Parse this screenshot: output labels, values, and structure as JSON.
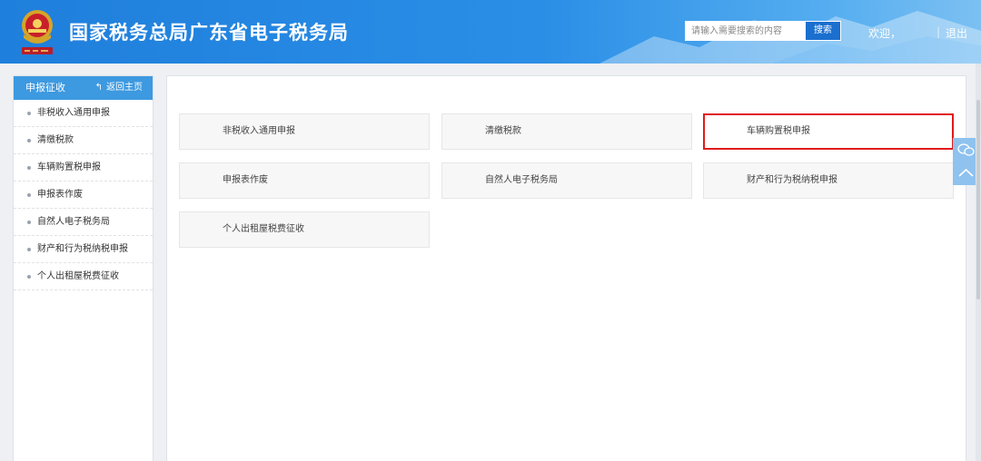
{
  "header": {
    "title": "国家税务总局广东省电子税务局",
    "search_placeholder": "请输入需要搜索的内容",
    "search_button": "搜索",
    "welcome": "欢迎，",
    "separator": "|",
    "logout": "退出"
  },
  "sidebar": {
    "heading": "申报征收",
    "back_label": "返回主页",
    "items": [
      {
        "label": "非税收入通用申报"
      },
      {
        "label": "清缴税款"
      },
      {
        "label": "车辆购置税申报"
      },
      {
        "label": "申报表作废"
      },
      {
        "label": "自然人电子税务局"
      },
      {
        "label": "财产和行为税纳税申报"
      },
      {
        "label": "个人出租屋税费征收"
      }
    ]
  },
  "main": {
    "cards": [
      {
        "label": "非税收入通用申报",
        "highlighted": false
      },
      {
        "label": "清缴税款",
        "highlighted": false
      },
      {
        "label": "车辆购置税申报",
        "highlighted": true
      },
      {
        "label": "申报表作废",
        "highlighted": false
      },
      {
        "label": "自然人电子税务局",
        "highlighted": false
      },
      {
        "label": "财产和行为税纳税申报",
        "highlighted": false
      },
      {
        "label": "个人出租屋税费征收",
        "highlighted": false
      }
    ]
  },
  "float_tools": [
    {
      "icon": "chat-bubbles-icon"
    },
    {
      "icon": "chevron-up-icon"
    }
  ],
  "colors": {
    "header_blue": "#2a8ee6",
    "sidebar_head": "#3d99e0",
    "highlight_border": "#e01b1b",
    "float_button": "#8fc2ef"
  }
}
